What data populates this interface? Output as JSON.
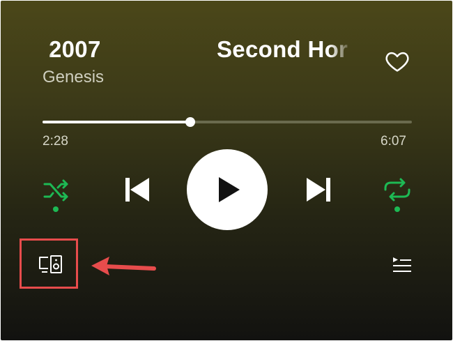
{
  "player": {
    "title_primary": "2007",
    "title_secondary": "Second Hor",
    "artist": "Genesis",
    "elapsed": "2:28",
    "duration": "6:07",
    "progress_fraction": 0.4
  },
  "controls": {
    "shuffle_active": true,
    "repeat_active": true,
    "icons": [
      "heart-icon",
      "shuffle-icon",
      "previous-icon",
      "play-icon",
      "next-icon",
      "repeat-icon",
      "devices-icon",
      "queue-icon"
    ]
  },
  "colors": {
    "accent": "#1db954",
    "annotation": "#e74c4c",
    "background_top": "#4b4719",
    "background_bottom": "#121210"
  }
}
